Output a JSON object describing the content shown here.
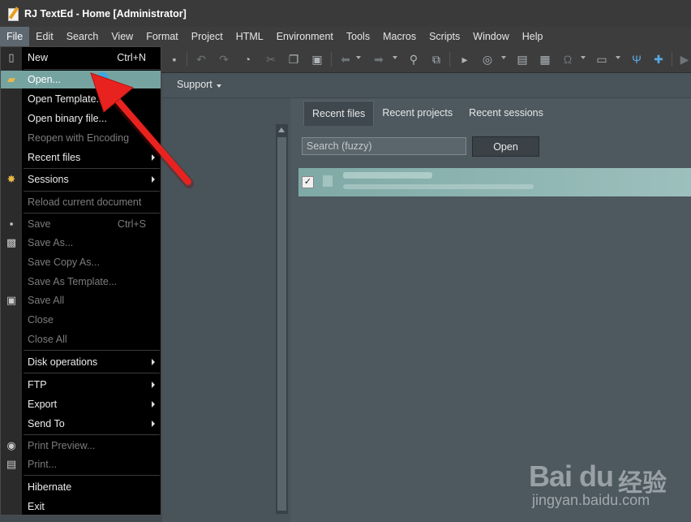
{
  "window": {
    "title": "RJ TextEd - Home [Administrator]"
  },
  "menubar": {
    "items": [
      "File",
      "Edit",
      "Search",
      "View",
      "Format",
      "Project",
      "HTML",
      "Environment",
      "Tools",
      "Macros",
      "Scripts",
      "Window",
      "Help"
    ]
  },
  "toolbar": {
    "icons": [
      "save-icon",
      "undo-icon",
      "redo-icon",
      "history-icon",
      "cut-icon",
      "copy-icon",
      "paste-icon",
      "back-icon",
      "forward-icon",
      "find-icon",
      "replace-icon",
      "run-icon",
      "browser-icon",
      "inspect-icon",
      "convert-icon",
      "special-char-icon",
      "print-icon",
      "tools-icon",
      "plugin-icon",
      "play-icon"
    ]
  },
  "main": {
    "support_label": "Support",
    "tabs": [
      {
        "label": "Recent files",
        "active": true
      },
      {
        "label": "Recent projects",
        "active": false
      },
      {
        "label": "Recent sessions",
        "active": false
      }
    ],
    "search": {
      "placeholder": "Search (fuzzy)",
      "value": ""
    },
    "open_button": "Open",
    "recent_row_checked": true
  },
  "file_menu": {
    "items": [
      {
        "label": "New",
        "shortcut": "Ctrl+N",
        "icon": "new-file-icon"
      },
      {
        "label": "Open...",
        "icon": "open-folder-icon",
        "highlighted": true
      },
      {
        "label": "Open Template..."
      },
      {
        "label": "Open binary file..."
      },
      {
        "label": "Reopen with Encoding",
        "disabled": true
      },
      {
        "label": "Recent files",
        "submenu": true
      },
      {
        "label": "Sessions",
        "submenu": true,
        "icon": "sessions-icon"
      },
      {
        "label": "Reload current document",
        "disabled": true
      },
      {
        "label": "Save",
        "shortcut": "Ctrl+S",
        "disabled": true,
        "icon": "save-icon"
      },
      {
        "label": "Save As...",
        "disabled": true,
        "icon": "save-as-icon"
      },
      {
        "label": "Save Copy As...",
        "disabled": true
      },
      {
        "label": "Save As Template...",
        "disabled": true
      },
      {
        "label": "Save All",
        "disabled": true,
        "icon": "save-all-icon"
      },
      {
        "label": "Close",
        "disabled": true
      },
      {
        "label": "Close All",
        "disabled": true
      },
      {
        "label": "Disk operations",
        "submenu": true
      },
      {
        "label": "FTP",
        "submenu": true
      },
      {
        "label": "Export",
        "submenu": true
      },
      {
        "label": "Send To",
        "submenu": true
      },
      {
        "label": "Print Preview...",
        "disabled": true,
        "icon": "print-preview-icon"
      },
      {
        "label": "Print...",
        "disabled": true,
        "icon": "printer-icon"
      },
      {
        "label": "Hibernate"
      },
      {
        "label": "Exit"
      }
    ]
  },
  "colors": {
    "menu_highlight": "#75a3a0",
    "arrow": "#e8231f",
    "background": "#48535a"
  },
  "watermark": {
    "logo": "Bai du",
    "cn": "经验",
    "url": "jingyan.baidu.com"
  }
}
